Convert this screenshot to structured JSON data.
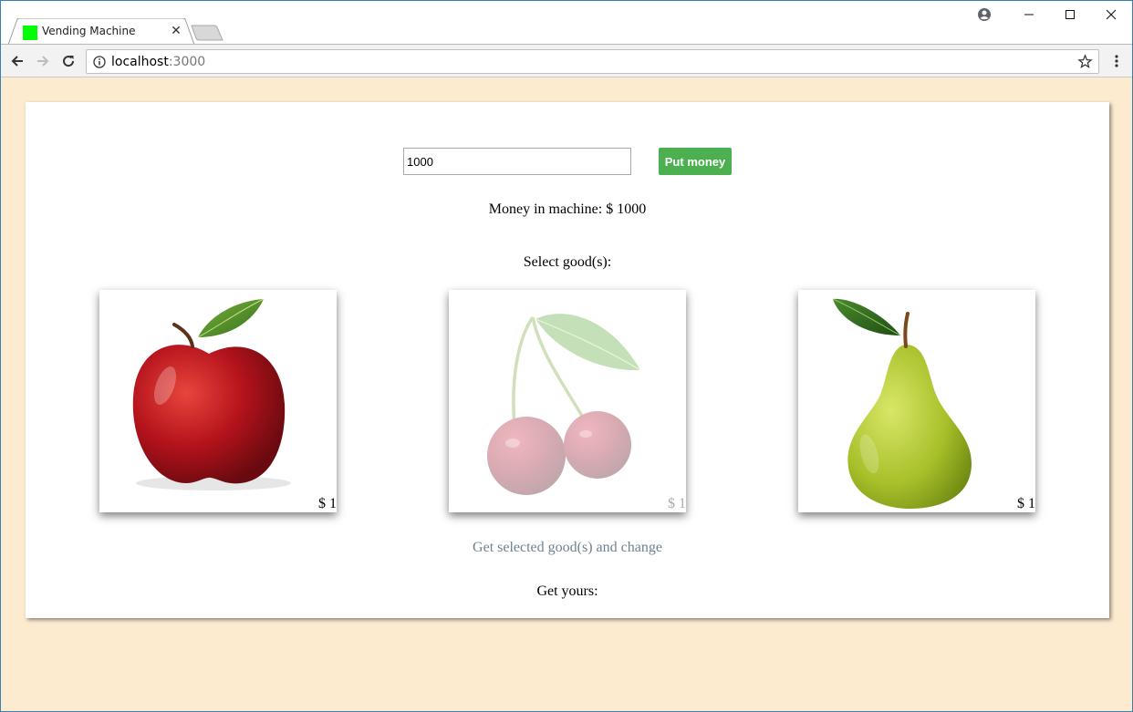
{
  "browser": {
    "tab_title": "Vending Machine",
    "url_host": "localhost",
    "url_port": ":3000"
  },
  "page": {
    "money_input_value": "1000",
    "put_money_label": "Put money",
    "money_in_machine": "Money in machine: $ 1000",
    "select_goods_label": "Select good(s):",
    "goods": [
      {
        "name": "apple",
        "price": "$ 1",
        "available": true
      },
      {
        "name": "cherry",
        "price": "$ 1",
        "available": false
      },
      {
        "name": "pear",
        "price": "$ 1",
        "available": true
      }
    ],
    "get_goods_label": "Get selected good(s) and change",
    "get_yours_label": "Get yours:"
  },
  "colors": {
    "page_background": "#fdebd0",
    "button_green": "#4caf50",
    "link_gray": "#708090",
    "favicon": "#00ff00"
  }
}
